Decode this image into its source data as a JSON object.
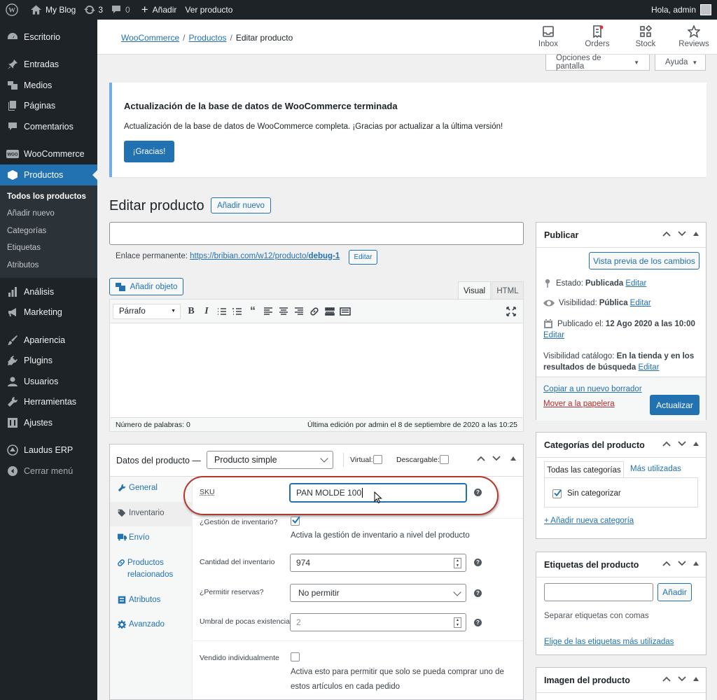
{
  "adminbar": {
    "site_name": "My Blog",
    "updates_count": "3",
    "comments_count": "0",
    "add_new": "Añadir",
    "view_product": "Ver producto",
    "greeting": "Hola, admin"
  },
  "sidebar": {
    "items": [
      {
        "label": "Escritorio",
        "icon": "dashboard-icon"
      },
      {
        "label": "Entradas",
        "icon": "pin-icon"
      },
      {
        "label": "Medios",
        "icon": "media-icon"
      },
      {
        "label": "Páginas",
        "icon": "pages-icon"
      },
      {
        "label": "Comentarios",
        "icon": "comments-icon"
      },
      {
        "label": "WooCommerce",
        "icon": "woo-icon"
      },
      {
        "label": "Productos",
        "icon": "products-icon"
      },
      {
        "label": "Análisis",
        "icon": "analytics-icon"
      },
      {
        "label": "Marketing",
        "icon": "megaphone-icon"
      },
      {
        "label": "Apariencia",
        "icon": "brush-icon"
      },
      {
        "label": "Plugins",
        "icon": "plugin-icon"
      },
      {
        "label": "Usuarios",
        "icon": "users-icon"
      },
      {
        "label": "Herramientas",
        "icon": "wrench-icon"
      },
      {
        "label": "Ajustes",
        "icon": "settings-icon"
      },
      {
        "label": "Laudus ERP",
        "icon": "laudus-icon"
      },
      {
        "label": "Cerrar menú",
        "icon": "collapse-icon"
      }
    ],
    "submenu": [
      "Todos los productos",
      "Añadir nuevo",
      "Categorías",
      "Etiquetas",
      "Atributos"
    ]
  },
  "header": {
    "breadcrumb": [
      "WooCommerce",
      "Productos",
      "Editar producto"
    ],
    "buttons": [
      "Inbox",
      "Orders",
      "Stock",
      "Reviews"
    ],
    "screen_options": "Opciones de pantalla",
    "help": "Ayuda"
  },
  "notice": {
    "title": "Actualización de la base de datos de WooCommerce terminada",
    "text": "Actualización de la base de datos de WooCommerce completa. ¡Gracias por actualizar a la última versión!",
    "button": "¡Gracias!"
  },
  "edit": {
    "title": "Editar producto",
    "add_new": "Añadir nuevo",
    "title_value": "",
    "permalink_label": "Enlace permanente:",
    "permalink_base": "https://bribian.com/w12/producto/",
    "permalink_slug": "debug-1",
    "permalink_edit": "Editar"
  },
  "editor": {
    "add_media": "Añadir objeto",
    "tab_visual": "Visual",
    "tab_html": "HTML",
    "format": "Párrafo",
    "word_count": "Número de palabras: 0",
    "last_edit": "Última edición por admin el 8 de septiembre de 2020 a las 10:25"
  },
  "product_data": {
    "title": "Datos del producto —",
    "type": "Producto simple",
    "virtual": "Virtual:",
    "downloadable": "Descargable:",
    "tabs": [
      "General",
      "Inventario",
      "Envío",
      "Productos relacionados",
      "Atributos",
      "Avanzado"
    ],
    "fields": {
      "sku_label": "SKU",
      "sku_value": "PAN MOLDE 100",
      "manage_stock_label": "¿Gestión de inventario?",
      "manage_stock_desc": "Activa la gestión de inventario a nivel del producto",
      "qty_label": "Cantidad del inventario",
      "qty_value": "974",
      "backorders_label": "¿Permitir reservas?",
      "backorders_value": "No permitir",
      "low_stock_label": "Umbral de pocas existencias",
      "low_stock_placeholder": "2",
      "sold_individually_label": "Vendido individualmente",
      "sold_individually_desc_1": "Activa esto para permitir que solo se pueda comprar uno de",
      "sold_individually_desc_2": "estos artículos en cada pedido"
    }
  },
  "publish": {
    "title": "Publicar",
    "preview": "Vista previa de los cambios",
    "status_label": "Estado:",
    "status_value": "Publicada",
    "visibility_label": "Visibilidad:",
    "visibility_value": "Pública",
    "published_label": "Publicado el:",
    "published_value": "12 Ago 2020 a las 10:00",
    "catalog_label": "Visibilidad catálogo:",
    "catalog_value_1": "En la tienda y en los",
    "catalog_value_2": "resultados de búsqueda",
    "edit": "Editar",
    "copy": "Copiar a un nuevo borrador",
    "trash": "Mover a la papelera",
    "update": "Actualizar"
  },
  "categories": {
    "title": "Categorías del producto",
    "tab_all": "Todas las categorías",
    "tab_most": "Más utilizadas",
    "item": "Sin categorizar",
    "add": "+ Añadir nueva categoría"
  },
  "tags": {
    "title": "Etiquetas del producto",
    "add": "Añadir",
    "hint": "Separar etiquetas con comas",
    "choose": "Elige de las etiquetas más utilizadas"
  },
  "image": {
    "title": "Imagen del producto"
  },
  "colors": {
    "accent": "#2271b1",
    "highlight": "#b3372e",
    "admin_bg": "#1d2327"
  }
}
